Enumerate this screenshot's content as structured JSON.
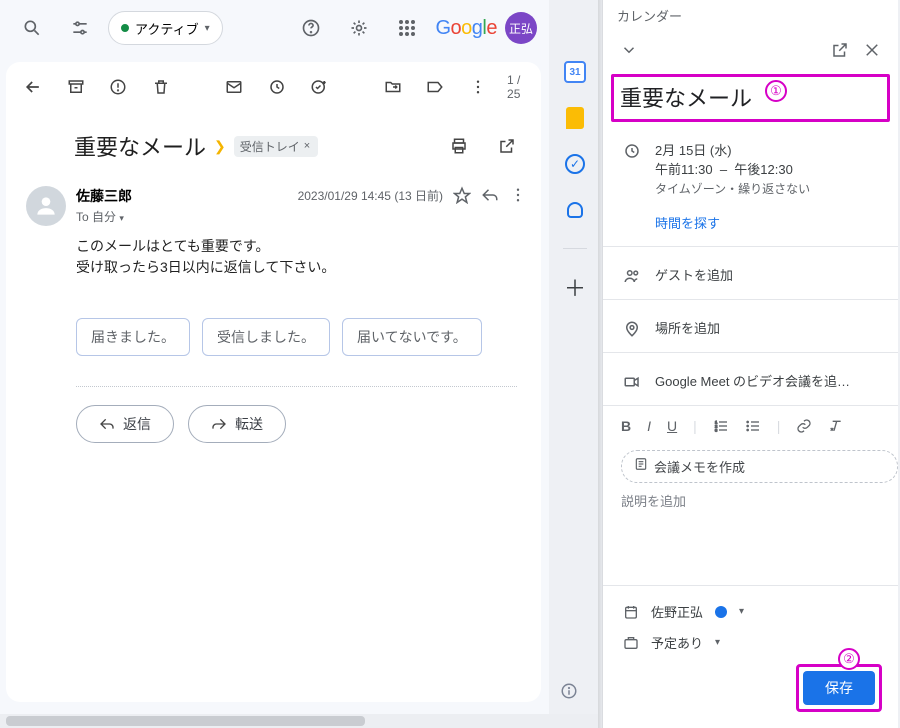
{
  "header": {
    "status": "アクティブ",
    "avatar": "正弘"
  },
  "toolbar": {
    "page_count": "1 / 25"
  },
  "email": {
    "subject": "重要なメール",
    "inbox_label": "受信トレイ",
    "sender": "佐藤三郎",
    "to": "To 自分",
    "date": "2023/01/29 14:45 (13 日前)",
    "body_line1": "このメールはとても重要です。",
    "body_line2": "受け取ったら3日以内に返信して下さい。",
    "suggest1": "届きました。",
    "suggest2": "受信しました。",
    "suggest3": "届いてないです。",
    "reply": "返信",
    "forward": "転送"
  },
  "dock": {
    "calendar_day": "31"
  },
  "cal": {
    "header_title": "カレンダー",
    "title": "重要なメール",
    "date_line": "2月 15日 (水)",
    "time_start": "午前11:30",
    "time_sep": "–",
    "time_end": "午後12:30",
    "tz_note": "タイムゾーン・繰り返さない",
    "find_time": "時間を探す",
    "guests": "ゲストを追加",
    "location": "場所を追加",
    "meet": "Google Meet のビデオ会議を追…",
    "memo_chip": "会議メモを作成",
    "description_ph": "説明を追加",
    "owner": "佐野正弘",
    "availability": "予定あり",
    "save": "保存"
  },
  "anno": {
    "one": "①",
    "two": "②"
  }
}
